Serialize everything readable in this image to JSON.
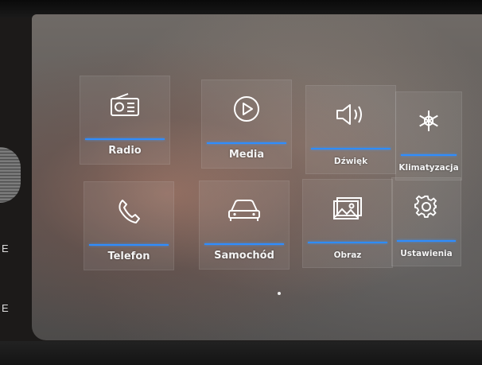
{
  "side": {
    "upper_mark": "E",
    "lower_mark": "E"
  },
  "tiles": [
    {
      "label": "Radio",
      "icon": "radio-icon"
    },
    {
      "label": "Media",
      "icon": "play-icon"
    },
    {
      "label": "Dźwięk",
      "icon": "speaker-icon"
    },
    {
      "label": "Klimatyzacja",
      "icon": "snowflake-icon"
    },
    {
      "label": "Telefon",
      "icon": "phone-icon"
    },
    {
      "label": "Samochód",
      "icon": "car-icon"
    },
    {
      "label": "Obraz",
      "icon": "image-icon"
    },
    {
      "label": "Ustawienia",
      "icon": "gear-icon"
    }
  ],
  "colors": {
    "accent": "#2e8dff",
    "label": "#f4f4f4",
    "icon_stroke": "#ffffff"
  }
}
